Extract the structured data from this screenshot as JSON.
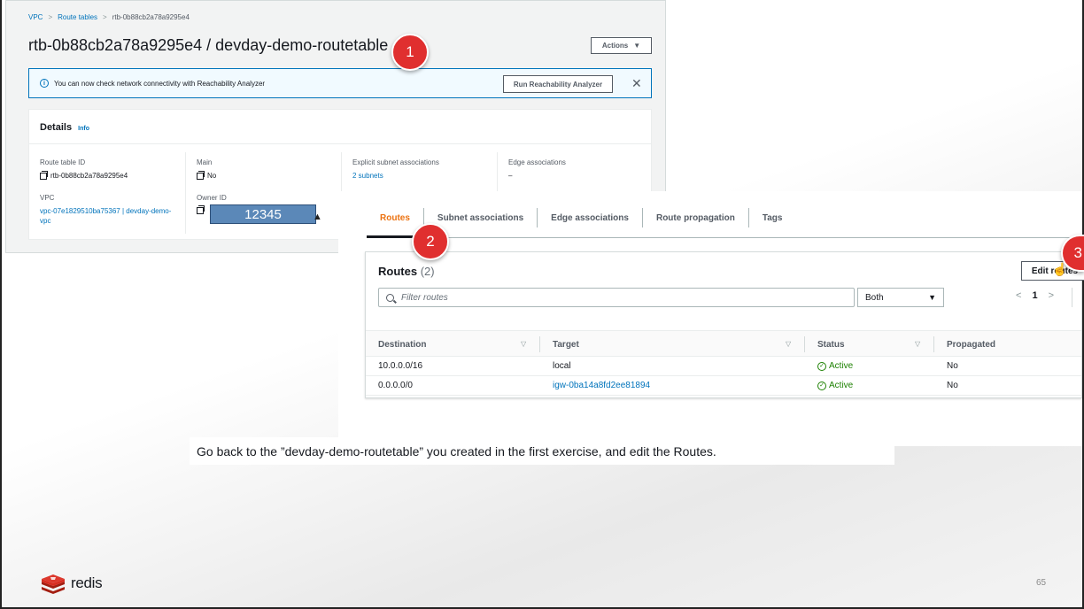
{
  "screenshot1": {
    "breadcrumb": [
      "VPC",
      "Route tables",
      "rtb-0b88cb2a78a9295e4"
    ],
    "title": "rtb-0b88cb2a78a9295e4 / devday-demo-routetable",
    "actions_label": "Actions",
    "banner": {
      "text": "You can now check network connectivity with Reachability Analyzer",
      "button": "Run Reachability Analyzer",
      "close": "✕"
    },
    "details": {
      "header": "Details",
      "info": "Info",
      "route_table_id_label": "Route table ID",
      "route_table_id": "rtb-0b88cb2a78a9295e4",
      "main_label": "Main",
      "main_value": "No",
      "explicit_label": "Explicit subnet associations",
      "explicit_value": "2 subnets",
      "edge_label": "Edge associations",
      "edge_value": "–",
      "vpc_label": "VPC",
      "vpc_value": "vpc-07e1829510ba75367 | devday-demo-vpc",
      "owner_label": "Owner ID",
      "owner_value": "12345"
    }
  },
  "screenshot2": {
    "tabs": [
      "Routes",
      "Subnet associations",
      "Edge associations",
      "Route propagation",
      "Tags"
    ],
    "routes_title": "Routes",
    "routes_count": "(2)",
    "edit_routes": "Edit routes",
    "filter_placeholder": "Filter routes",
    "filter_select": "Both",
    "page": "1",
    "columns": [
      "Destination",
      "Target",
      "Status",
      "Propagated"
    ],
    "rows": [
      {
        "destination": "10.0.0.0/16",
        "target": "local",
        "status": "Active",
        "propagated": "No"
      },
      {
        "destination": "0.0.0.0/0",
        "target": "igw-0ba14a8fd2ee81894",
        "status": "Active",
        "propagated": "No"
      }
    ]
  },
  "steps": [
    "1",
    "2",
    "3"
  ],
  "caption": "Go back to the ”devday-demo-routetable” you created in the first exercise, and edit the Routes.",
  "logo_text": "redis",
  "page_number": "65",
  "colors": {
    "step": "#e02f2f",
    "aws_link": "#0073bb",
    "active_tab": "#ec7211",
    "status_active": "#1d8102",
    "redis_red": "#dc382d"
  }
}
